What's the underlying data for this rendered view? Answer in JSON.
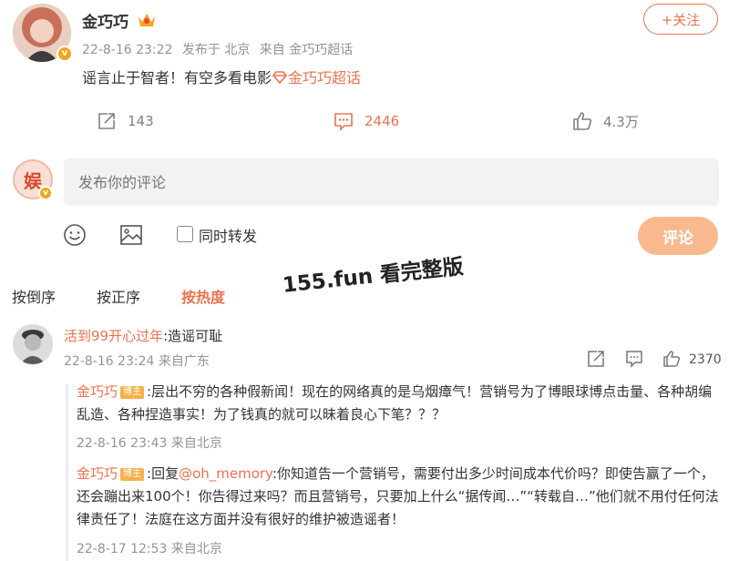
{
  "post": {
    "author": "金巧巧",
    "date": "22-8-16 23:22",
    "published_at": "发布于 北京",
    "source": "来自 金巧巧超话",
    "text": "谣言止于智者！有空多看电影",
    "topic": "金巧巧超话",
    "follow_label": "+关注",
    "reposts": "143",
    "comments": "2446",
    "likes": "4.3万"
  },
  "composer": {
    "avatar_char": "娱",
    "placeholder": "发布你的评论",
    "repost_label": "同时转发",
    "submit_label": "评论"
  },
  "sort_tabs": [
    "按倒序",
    "按正序",
    "按热度"
  ],
  "active_sort": "按热度",
  "watermark": "155.fun 看完整版",
  "comment": {
    "user": "活到99开心过年",
    "text": ":造谣可耻",
    "meta": "22-8-16 23:24 来自广东",
    "likes": "2370"
  },
  "replies": [
    {
      "user": "金巧巧",
      "tag": "博主",
      "text": ":层出不穷的各种假新闻！现在的网络真的是乌烟瘴气！营销号为了博眼球博点击量、各种胡编乱造、各种捏造事实！为了钱真的就可以昧着良心下笔？？？",
      "meta": "22-8-16 23:43 来自北京"
    },
    {
      "user": "金巧巧",
      "tag": "博主",
      "prefix": ":回复",
      "mention": "@oh_memory",
      "text": ":你知道告一个营销号，需要付出多少时间成本代价吗？即使告赢了一个，还会蹦出来100个！你告得过来吗？而且营销号，只要加上什么“据传闻…”“转载自…”他们就不用付任何法律责任了！法庭在这方面并没有很好的维护被造谣者！",
      "meta": "22-8-17 12:53 来自北京"
    }
  ],
  "colors": {
    "accent": "#eb7350",
    "meta_gray": "#939393",
    "submit_bg": "#f9b98e",
    "tag_bg": "#f7b04c"
  },
  "icons": [
    "repost-icon",
    "comment-icon",
    "like-icon",
    "emoji-icon",
    "image-icon",
    "crown-icon",
    "verified-icon"
  ]
}
